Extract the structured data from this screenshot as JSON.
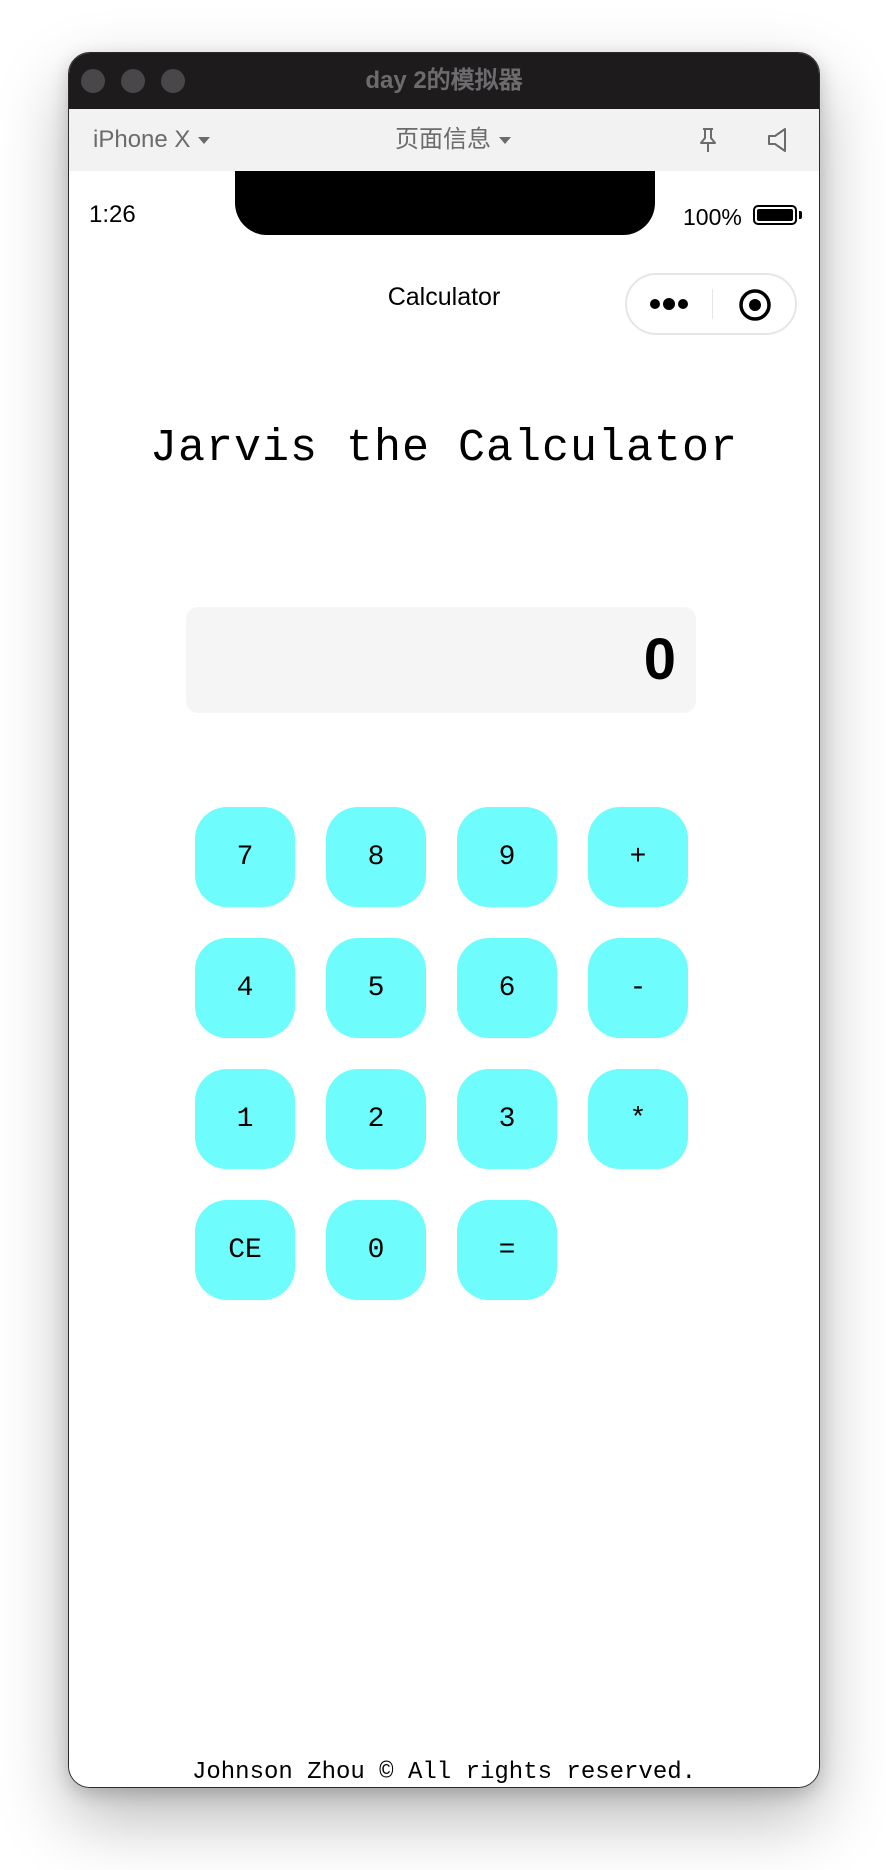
{
  "window": {
    "title": "day 2的模拟器"
  },
  "toolbar": {
    "device_label": "iPhone X",
    "page_info_label": "页面信息",
    "pin_icon": "pin-icon",
    "sound_icon": "speaker-icon"
  },
  "status_bar": {
    "time": "1:26",
    "battery_percent": "100%",
    "battery_level": 1.0
  },
  "nav": {
    "title": "Calculator",
    "more_icon": "more-dots-icon",
    "close_icon": "target-close-icon"
  },
  "app": {
    "heading": "Jarvis the Calculator",
    "display_value": "0",
    "key_color": "#6ffcfd",
    "keys": [
      [
        "7",
        "8",
        "9",
        "+"
      ],
      [
        "4",
        "5",
        "6",
        "-"
      ],
      [
        "1",
        "2",
        "3",
        "*"
      ],
      [
        "CE",
        "0",
        "="
      ]
    ],
    "footer": "Johnson Zhou © All rights reserved."
  }
}
